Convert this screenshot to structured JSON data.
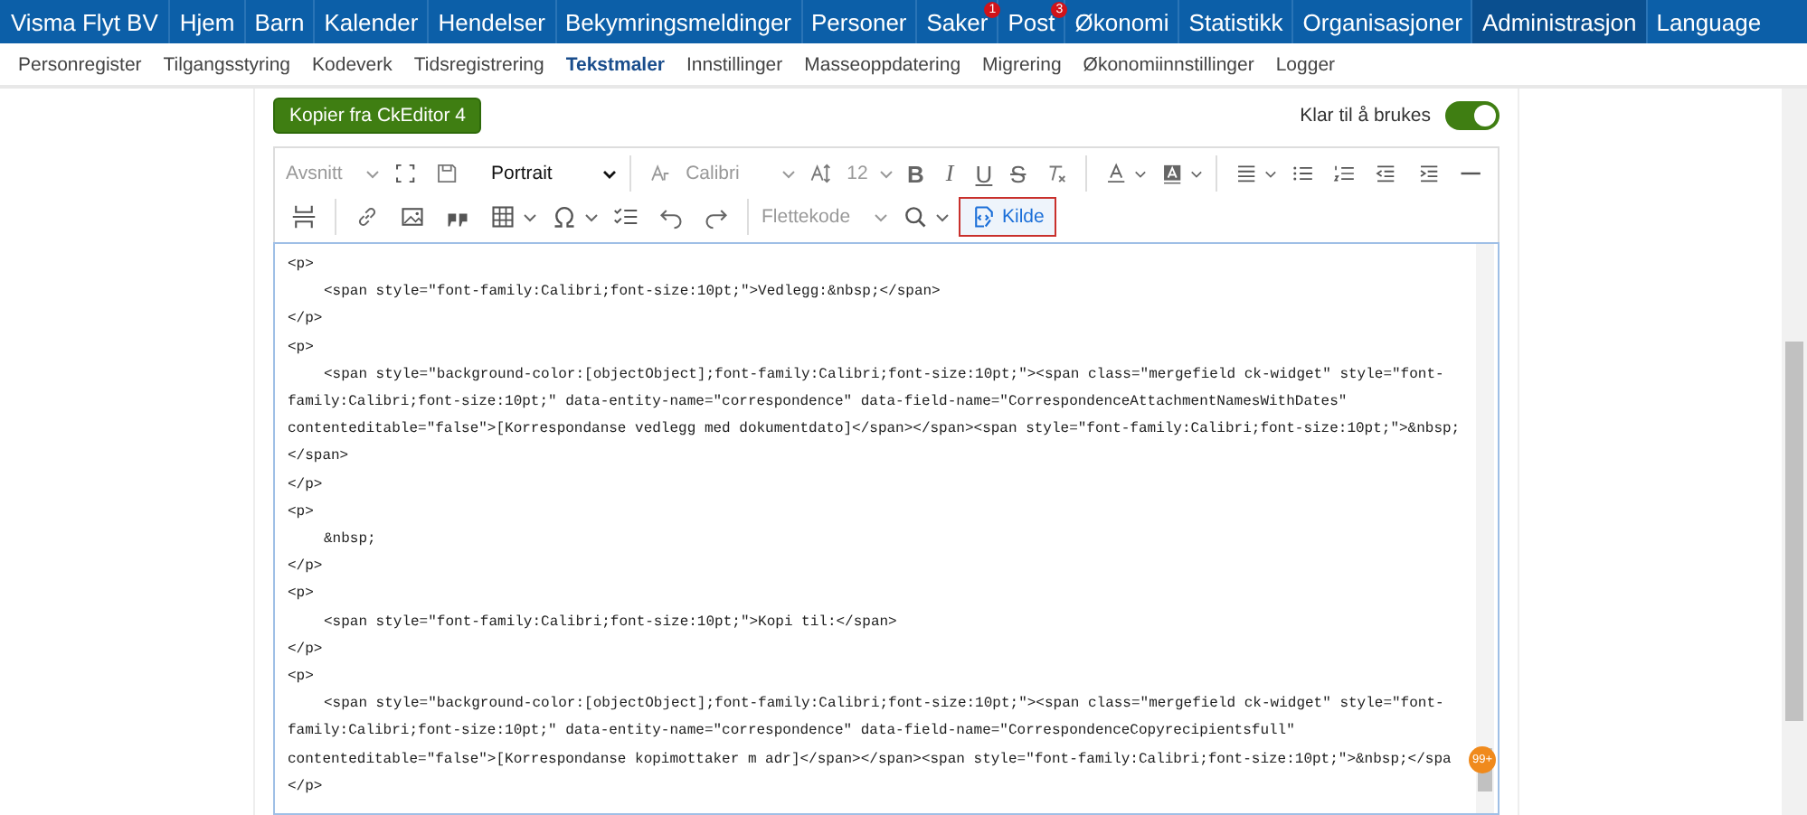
{
  "top_nav": {
    "brand": "Visma Flyt BV",
    "items": [
      {
        "label": "Hjem",
        "selected": false
      },
      {
        "label": "Barn",
        "selected": false
      },
      {
        "label": "Kalender",
        "selected": false
      },
      {
        "label": "Hendelser",
        "selected": false
      },
      {
        "label": "Bekymringsmeldinger",
        "selected": false
      },
      {
        "label": "Personer",
        "selected": false
      },
      {
        "label": "Saker",
        "selected": false,
        "badge": "1"
      },
      {
        "label": "Post",
        "selected": false,
        "badge": "3"
      },
      {
        "label": "Økonomi",
        "selected": false
      },
      {
        "label": "Statistikk",
        "selected": false
      },
      {
        "label": "Organisasjoner",
        "selected": false
      },
      {
        "label": "Administrasjon",
        "selected": true
      }
    ],
    "language": "Language"
  },
  "sub_nav": [
    {
      "label": "Personregister",
      "selected": false
    },
    {
      "label": "Tilgangsstyring",
      "selected": false
    },
    {
      "label": "Kodeverk",
      "selected": false
    },
    {
      "label": "Tidsregistrering",
      "selected": false
    },
    {
      "label": "Tekstmaler",
      "selected": true
    },
    {
      "label": "Innstillinger",
      "selected": false
    },
    {
      "label": "Masseoppdatering",
      "selected": false
    },
    {
      "label": "Migrering",
      "selected": false
    },
    {
      "label": "Økonomiinnstillinger",
      "selected": false
    },
    {
      "label": "Logger",
      "selected": false
    }
  ],
  "copy_button": "Kopier fra CkEditor 4",
  "ready_toggle": {
    "label": "Klar til å brukes",
    "on": true
  },
  "toolbar": {
    "paragraph_style": {
      "value": "Avsnitt",
      "disabled": true
    },
    "orientation": {
      "value": "Portrait",
      "disabled": false
    },
    "font": {
      "value": "Calibri",
      "disabled": true
    },
    "font_size": {
      "value": "12",
      "disabled": true
    },
    "bold": "B",
    "italic": "I",
    "underline": "U",
    "strike": "S",
    "merge_field": {
      "value": "Flettekode",
      "disabled": true
    },
    "source_button": {
      "label": "Kilde",
      "on": true
    }
  },
  "source_lines": [
    {
      "text": "<p>",
      "indent": false
    },
    {
      "text": "<span style=\"font-family:Calibri;font-size:10pt;\">Vedlegg:&nbsp;</span>",
      "indent": true
    },
    {
      "text": "</p>",
      "indent": false
    },
    {
      "text": "<p>",
      "indent": false
    },
    {
      "text": "<span style=\"background-color:[objectObject];font-family:Calibri;font-size:10pt;\"><span class=\"mergefield ck-widget\" style=\"font-",
      "indent": true
    },
    {
      "text": "family:Calibri;font-size:10pt;\" data-entity-name=\"correspondence\" data-field-name=\"CorrespondenceAttachmentNamesWithDates\"",
      "indent": false
    },
    {
      "text": "contenteditable=\"false\">[Korrespondanse vedlegg med dokumentdato]</span></span><span style=\"font-family:Calibri;font-size:10pt;\">&nbsp;",
      "indent": false
    },
    {
      "text": "</span>",
      "indent": false
    },
    {
      "text": "</p>",
      "indent": false
    },
    {
      "text": "<p>",
      "indent": false
    },
    {
      "text": "&nbsp;",
      "indent": true
    },
    {
      "text": "</p>",
      "indent": false
    },
    {
      "text": "<p>",
      "indent": false
    },
    {
      "text": "<span style=\"font-family:Calibri;font-size:10pt;\">Kopi til:</span>",
      "indent": true
    },
    {
      "text": "</p>",
      "indent": false
    },
    {
      "text": "<p>",
      "indent": false
    },
    {
      "text": "<span style=\"background-color:[objectObject];font-family:Calibri;font-size:10pt;\"><span class=\"mergefield ck-widget\" style=\"font-",
      "indent": true
    },
    {
      "text": "family:Calibri;font-size:10pt;\" data-entity-name=\"correspondence\" data-field-name=\"CorrespondenceCopyrecipientsfull\"",
      "indent": false
    },
    {
      "text": "contenteditable=\"false\">[Korrespondanse kopimottaker m adr]</span></span><span style=\"font-family:Calibri;font-size:10pt;\">&nbsp;</spa",
      "indent": false
    },
    {
      "text": "</p>",
      "indent": false
    }
  ],
  "notification_badge": "99+"
}
